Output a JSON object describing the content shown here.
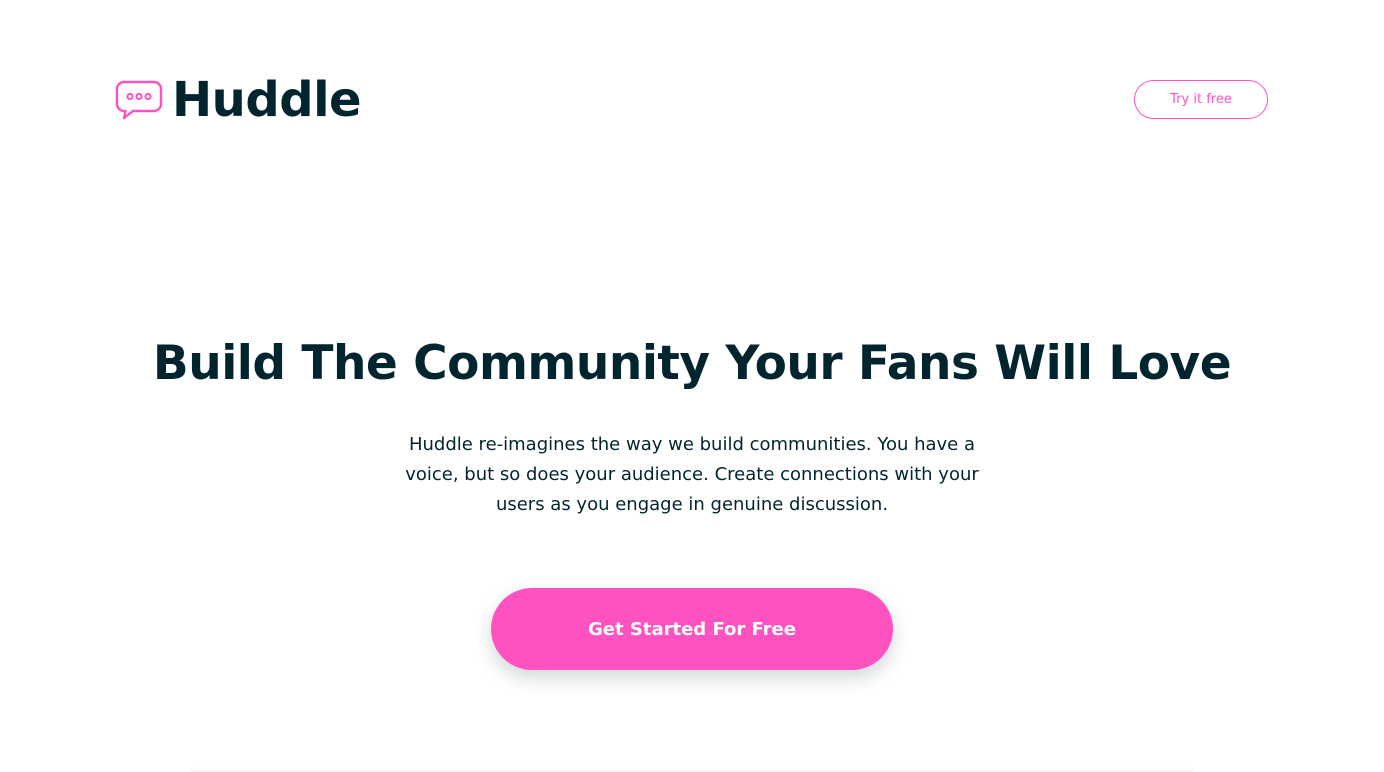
{
  "brand": {
    "name": "Huddle",
    "accent_color": "#ff52c1",
    "text_color": "#00252e",
    "logo_icon": "speech-bubble-icon"
  },
  "header": {
    "cta_label": "Try it free"
  },
  "hero": {
    "title": "Build The Community Your Fans Will Love",
    "description": "Huddle re-imagines the way we build communities. You have a voice, but so does your audience. Create connections with your users as you engage in genuine discussion.",
    "cta_label": "Get Started For Free"
  }
}
